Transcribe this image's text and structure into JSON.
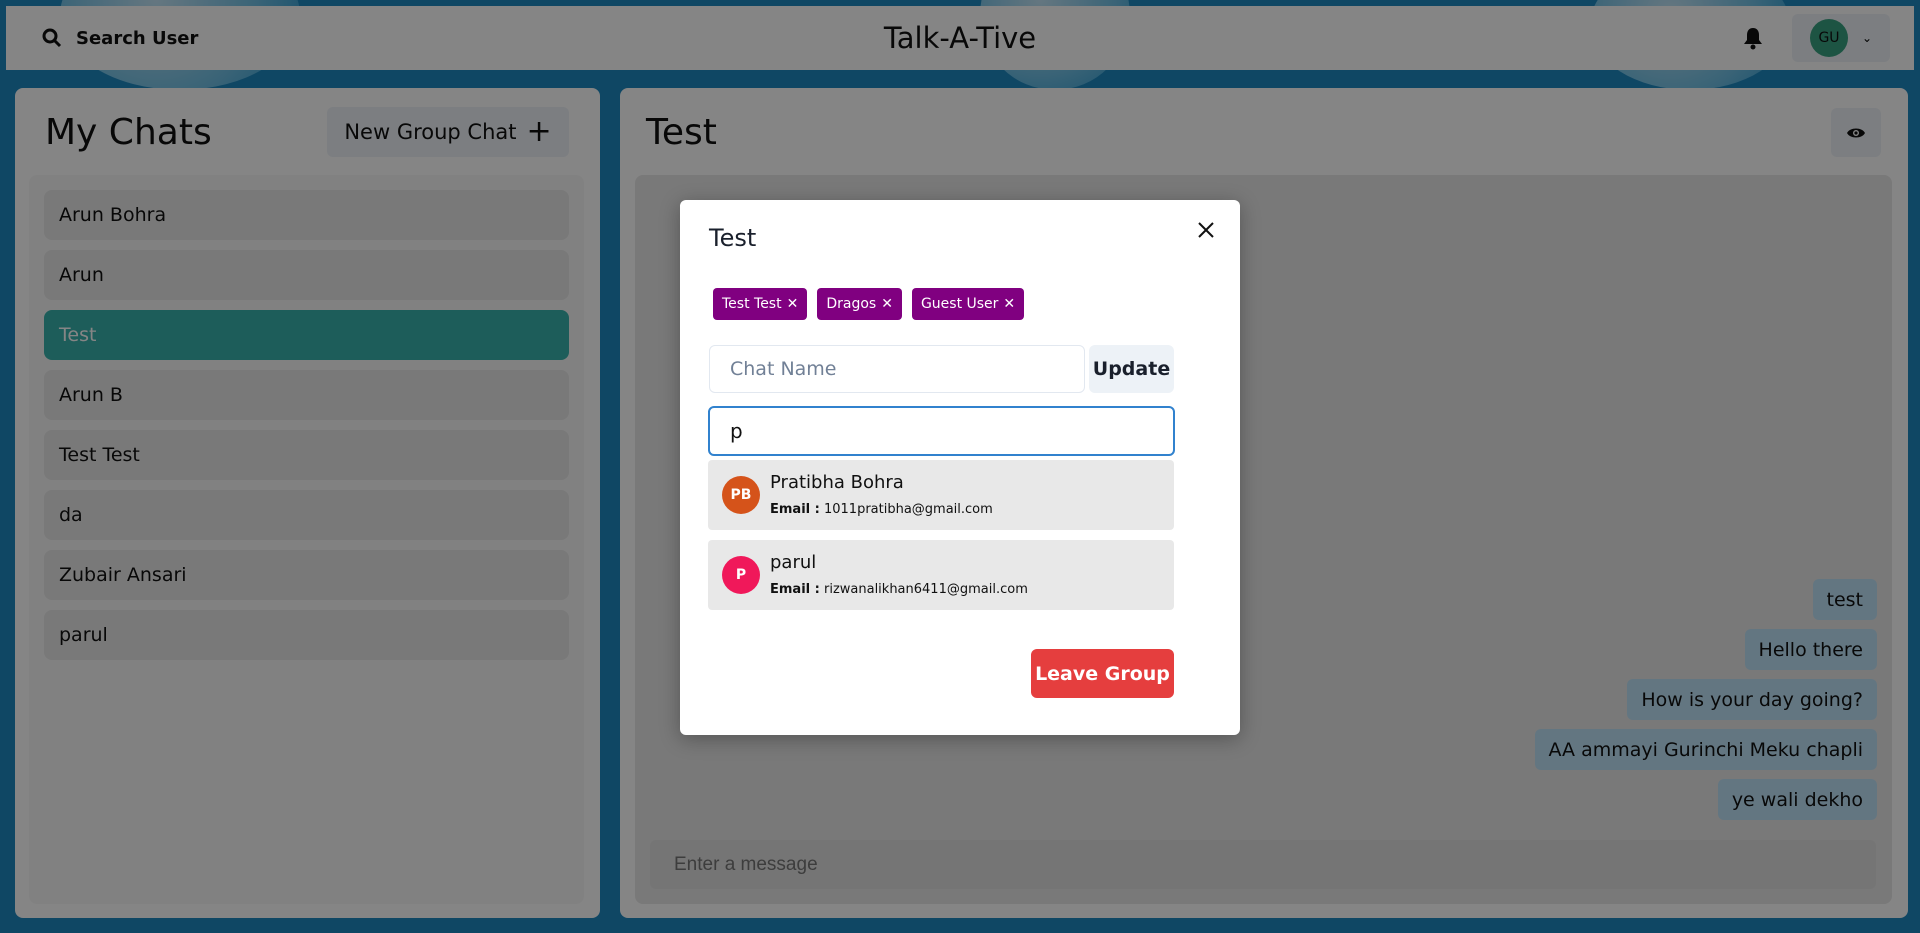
{
  "navbar": {
    "search_label": "Search User",
    "app_title": "Talk-A-Tive",
    "user_initials": "GU",
    "avatar_color": "#38a181"
  },
  "sidebar": {
    "title": "My Chats",
    "new_group_label": "New Group Chat",
    "chats": [
      {
        "name": "Arun Bohra",
        "selected": false
      },
      {
        "name": "Arun",
        "selected": false
      },
      {
        "name": "Test",
        "selected": true
      },
      {
        "name": "Arun B",
        "selected": false
      },
      {
        "name": "Test Test",
        "selected": false
      },
      {
        "name": "da",
        "selected": false
      },
      {
        "name": "Zubair Ansari",
        "selected": false
      },
      {
        "name": "parul",
        "selected": false
      }
    ]
  },
  "chat": {
    "title": "Test",
    "messages": [
      "test",
      "Hello there",
      "How is your day going?",
      "AA ammayi Gurinchi Meku chapli",
      "ye wali dekho"
    ],
    "input_placeholder": "Enter a message"
  },
  "modal": {
    "title": "Test",
    "members": [
      "Test Test",
      "Dragos",
      "Guest User"
    ],
    "chat_name_placeholder": "Chat Name",
    "update_label": "Update",
    "search_value": "p",
    "results": [
      {
        "name": "Pratibha Bohra",
        "initials": "PB",
        "email_label": "Email :",
        "email": "1011pratibha@gmail.com",
        "color": "#d5531a"
      },
      {
        "name": "parul",
        "initials": "P",
        "email_label": "Email :",
        "email": "rizwanalikhan6411@gmail.com",
        "color": "#f0185a"
      }
    ],
    "leave_label": "Leave Group"
  }
}
